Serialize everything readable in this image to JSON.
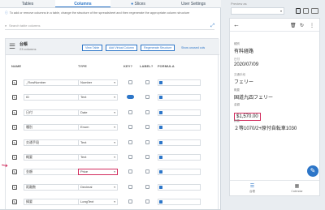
{
  "tabs": [
    {
      "label": "Tables",
      "active": false
    },
    {
      "label": "Columns",
      "active": true
    },
    {
      "label": "Slices",
      "active": false
    },
    {
      "label": "User Settings",
      "active": false
    }
  ],
  "hint": "To add or remove columns in a table, change the structure of the spreadsheet and then regenerate the appropriate column structure",
  "search": {
    "placeholder": "Search table columns"
  },
  "table_card": {
    "title": "台帳",
    "subtitle": "23 columns",
    "buttons": [
      "View Table",
      "Add Virtual Column",
      "Regenerate Structure"
    ],
    "link": "Show unused cols"
  },
  "column_headers": [
    "NAME",
    "TYPE",
    "KEY?",
    "LABEL?",
    "FORMULA"
  ],
  "columns": [
    {
      "name": "_RowNumber",
      "type": "Number",
      "key": false,
      "label": false
    },
    {
      "name": "ID",
      "type": "Text",
      "key": true,
      "label": false
    },
    {
      "name": "日付",
      "type": "Date",
      "key": false,
      "label": false
    },
    {
      "name": "種別",
      "type": "Enum",
      "key": false,
      "label": false
    },
    {
      "name": "交通手段",
      "type": "Text",
      "key": false,
      "label": false
    },
    {
      "name": "概要",
      "type": "Text",
      "key": false,
      "label": false
    },
    {
      "name": "金額",
      "type": "Price",
      "key": false,
      "label": false,
      "highlighted": true
    },
    {
      "name": "距離数",
      "type": "Decimal",
      "key": false,
      "label": false
    },
    {
      "name": "摘要",
      "type": "LongText",
      "key": false,
      "label": false
    }
  ],
  "preview": {
    "label": "Preview as",
    "user": "",
    "device_icons": [
      "phone-icon",
      "tablet-icon",
      "desktop-icon"
    ],
    "fields": [
      {
        "label": "種別",
        "value": "有料経路"
      },
      {
        "label": "日付",
        "value": "2020/07/09"
      },
      {
        "label": "交通手段",
        "value": "フェリー"
      },
      {
        "label": "概要",
        "value": "国道九四フェリー"
      },
      {
        "label": "金額",
        "value": "$1,570.00",
        "highlighted": true
      },
      {
        "label": "摘要",
        "value": "２等1070/2+原付自転車1030"
      }
    ],
    "nav": [
      {
        "label": "台帳",
        "icon": "list-icon",
        "active": true
      },
      {
        "label": "Calendar",
        "icon": "calendar-icon",
        "active": false
      }
    ]
  },
  "colors": {
    "accent": "#2d76c8",
    "highlight": "#d22d5e"
  }
}
